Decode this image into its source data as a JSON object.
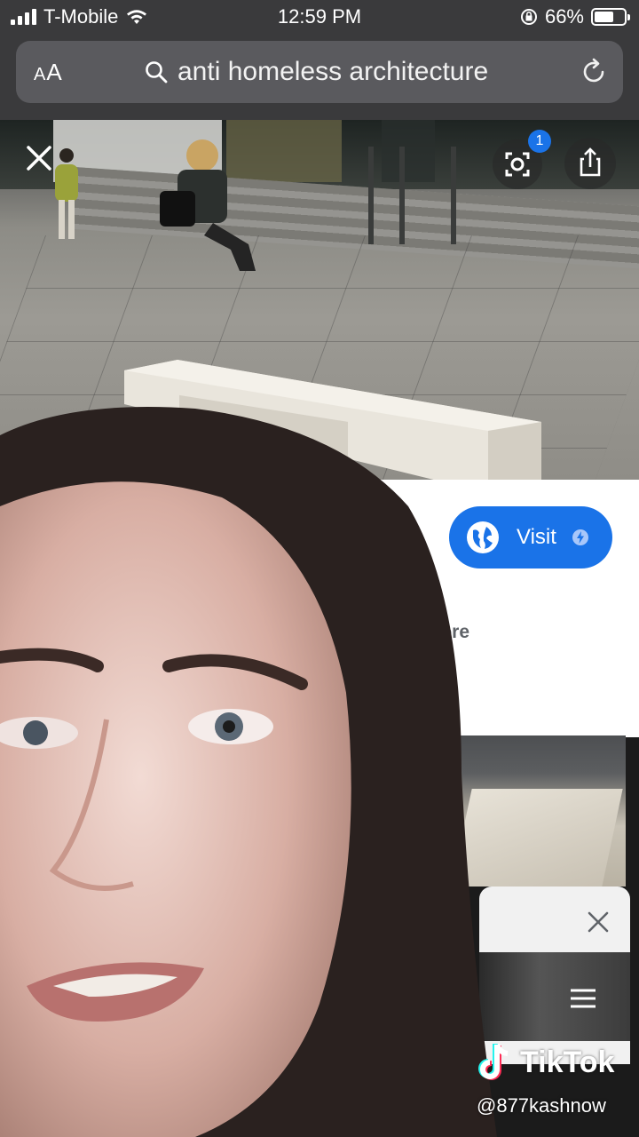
{
  "status_bar": {
    "carrier": "T-Mobile",
    "time": "12:59 PM",
    "battery_percent": "66%",
    "battery_level": 0.66
  },
  "browser": {
    "text_size_label": "AA",
    "search_query": "anti homeless architecture"
  },
  "image_viewer": {
    "lens_badge_count": "1"
  },
  "result_panel": {
    "visit_label": "Visit",
    "ellipsis": ".",
    "learn_more_label": "rn More"
  },
  "watermark": {
    "brand": "TikTok",
    "username": "@877kashnow"
  },
  "colors": {
    "visit_button": "#1a73e8",
    "status_bar_bg": "#3a3a3c",
    "url_bar_bg": "#5a5a5e"
  },
  "icons": [
    "wifi-icon",
    "orientation-lock-icon",
    "search-icon",
    "reload-icon",
    "close-icon",
    "lens-icon",
    "share-icon",
    "globe-icon",
    "bolt-icon",
    "menu-icon",
    "tiktok-logo-icon"
  ]
}
